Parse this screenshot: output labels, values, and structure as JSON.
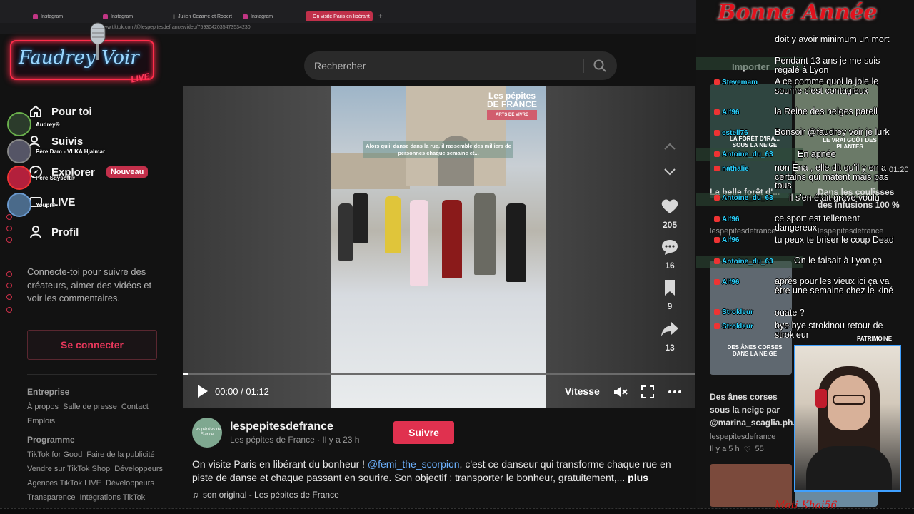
{
  "browser": {
    "tabs": [
      {
        "label": "Instagram",
        "color": "#c13584"
      },
      {
        "label": "Instagram",
        "color": "#c13584"
      },
      {
        "label": "Julien Cezarre et Robert",
        "color": "#333333"
      },
      {
        "label": "Instagram",
        "color": "#c13584"
      },
      {
        "label": "On visite Paris en libérant",
        "color": "#111111"
      }
    ],
    "url": "www.tiktok.com/@lespepitesdefrance/video/7593042035473534230"
  },
  "overlay": {
    "logo_text": "Faudrey Voir",
    "logo_live": "LIVE",
    "banner": "Bonne Année",
    "viewers": [
      {
        "name": "Audrey®"
      },
      {
        "name": "Père Dam - VLKA Hjalmar"
      },
      {
        "name": "Père Sqysoft®"
      },
      {
        "name": "Youpi®"
      }
    ],
    "streamer_tag": "Moti Khai56"
  },
  "nav": {
    "logo": "TikTok",
    "items": [
      {
        "label": "Pour toi",
        "icon": "home-icon"
      },
      {
        "label": "Suivis",
        "icon": "following-icon"
      },
      {
        "label": "Explorer",
        "icon": "compass-icon",
        "badge": "Nouveau"
      },
      {
        "label": "LIVE",
        "icon": "live-icon"
      },
      {
        "label": "Profil",
        "icon": "profile-icon"
      }
    ],
    "login_prompt": "Connecte-toi pour suivre des créateurs, aimer des vidéos et voir les commentaires.",
    "login_button": "Se connecter"
  },
  "footer": {
    "company_heading": "Entreprise",
    "company_links": [
      "À propos",
      "Salle de presse",
      "Contact"
    ],
    "company_links_2": [
      "Emplois"
    ],
    "program_heading": "Programme",
    "program_links_1": [
      "TikTok for Good",
      "Faire de la publicité"
    ],
    "program_links_2": [
      "Vendre sur TikTok Shop",
      "Développeurs"
    ],
    "program_links_3": [
      "Agences TikTok LIVE",
      "Développeurs"
    ],
    "program_links_4": [
      "Transparence",
      "Intégrations TikTok"
    ]
  },
  "search": {
    "placeholder": "Rechercher"
  },
  "video": {
    "brand_overlay_1": "Les pépites",
    "brand_overlay_2": "DE FRANCE",
    "brand_overlay_3": "ARTS DE VIVRE",
    "caption_overlay": "Alors qu'il danse dans la rue, il rassemble des milliers de personnes chaque semaine et...",
    "time": "00:00 / 01:12",
    "progress": 0.01,
    "speed_label": "Vitesse"
  },
  "actions": {
    "likes": "205",
    "comments": "16",
    "saves": "9",
    "shares": "13"
  },
  "author": {
    "avatar_text": "Les pépites de France",
    "handle": "lespepitesdefrance",
    "sub": "Les pépites de France · Il y a 23 h",
    "follow": "Suivre"
  },
  "description": {
    "prefix": "On visite Paris en libérant du bonheur ! ",
    "mention": "@femi_the_scorpion",
    "rest": ", c'est ce danseur qui transforme chaque rue en piste de danse et chaque passant en sourire. Son objectif : transporter le bonheur, gratuitement,...",
    "more": "plus",
    "sound": "son original - Les pépites de France"
  },
  "recommended": {
    "import_label": "Importer",
    "time_label": "01:20",
    "items": [
      {
        "title": "La belle forêt d'...",
        "meta": "lespepitesdefrance"
      },
      {
        "title": "Dans les coulisses des infusions 100 %",
        "meta": "lespepitesdefrance"
      },
      {
        "title": "Des ânes corses sous la neige par @marina_scaglia.ph...",
        "meta": "lespepitesdefrance",
        "meta2": "Il y a 5 h",
        "likes": "55"
      }
    ],
    "thumb_labels": [
      "LA FORÊT D'IRA... SOUS LA NEIGE",
      "LE VRAI GOÛT DES PLANTES",
      "DES ÂNES CORSES DANS LA NEIGE",
      "PATRIMOINE"
    ]
  },
  "chat": [
    {
      "user": "",
      "text": "doit y avoir minimum un mort"
    },
    {
      "user": "",
      "text": "Pendant 13 ans je me suis régalé à Lyon"
    },
    {
      "user": "Stevemam",
      "text": "A ce comme quoi la joie le sourire c'est contagieux"
    },
    {
      "user": "Alf96",
      "text": "la Reine des neiges pareil"
    },
    {
      "user": "estell76",
      "text": "Bonsoir @faudrey voir je lurk"
    },
    {
      "user": "Antoine_du_63",
      "text": "En apnée"
    },
    {
      "user": "nathalie",
      "text": "non Ena , elle dit qu'il y en a certains qui matent mais pas tous"
    },
    {
      "user": "Antoine_du_63",
      "text": "il s'en était grave voulu"
    },
    {
      "user": "Alf96",
      "text": "ce sport est tellement dangereux"
    },
    {
      "user": "Alf96",
      "text": "tu peux te briser le coup Dead"
    },
    {
      "user": "Antoine_du_63",
      "text": "On le faisait à Lyon ça"
    },
    {
      "user": "Alf96",
      "text": "après pour les vieux ici ça va être une semaine chez le kiné"
    },
    {
      "user": "Strokleur",
      "text": "ouate ?"
    },
    {
      "user": "Strokleur",
      "text": "bye bye strokinou retour de strokleur"
    }
  ]
}
